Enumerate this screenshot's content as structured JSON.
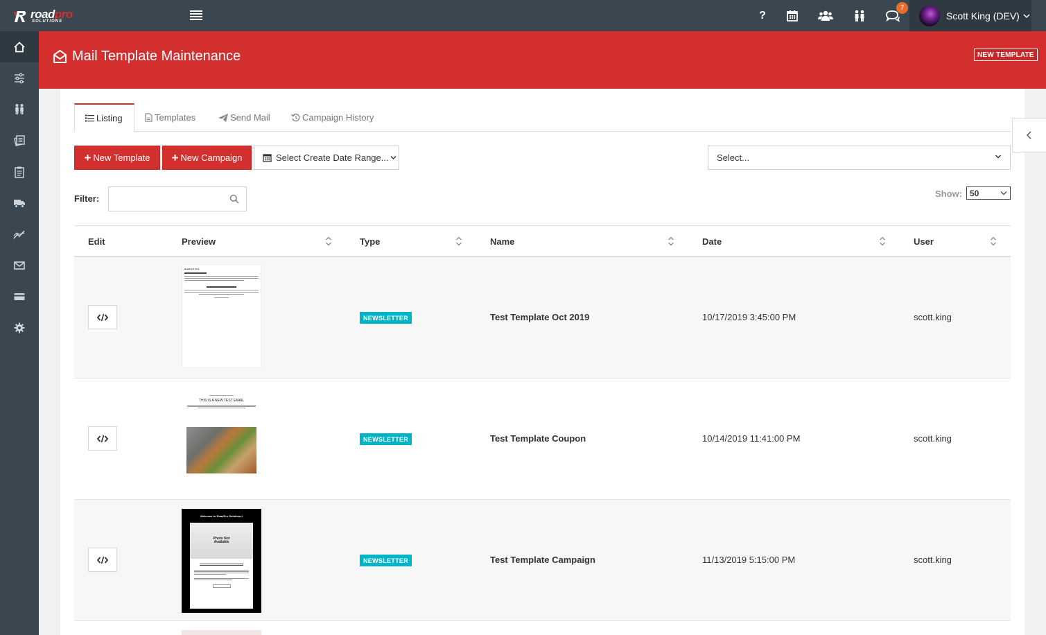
{
  "app": {
    "logo_main": "road",
    "logo_accent": "pro",
    "logo_sub": "SOLUTIONS",
    "notification_count": "7",
    "user_name": "Scott King (DEV)",
    "help_label": "?"
  },
  "page": {
    "title": "Mail Template Maintenance",
    "new_template_badge": "NEW TEMPLATE"
  },
  "tabs": [
    {
      "label": "Listing",
      "icon": "list-icon",
      "active": true
    },
    {
      "label": "Templates",
      "icon": "file-icon",
      "active": false
    },
    {
      "label": "Send Mail",
      "icon": "paper-plane-icon",
      "active": false
    },
    {
      "label": "Campaign History",
      "icon": "history-icon",
      "active": false
    }
  ],
  "toolbar": {
    "new_template": "New Template",
    "new_campaign": "New Campaign",
    "date_range": "Select Create Date Range...",
    "select_placeholder": "Select..."
  },
  "filter": {
    "label": "Filter:",
    "value": "",
    "show_label": "Show:",
    "show_value": "50"
  },
  "table": {
    "columns": [
      "Edit",
      "Preview",
      "Type",
      "Name",
      "Date",
      "User"
    ],
    "rows": [
      {
        "type": "NEWSLETTER",
        "name": "Test Template Oct 2019",
        "date": "10/17/2019 3:45:00 PM",
        "user": "scott.king",
        "preview_title": "Heading 2 here",
        "preview_sub": ""
      },
      {
        "type": "NEWSLETTER",
        "name": "Test Template Coupon",
        "date": "10/14/2019 11:41:00 PM",
        "user": "scott.king",
        "preview_title": "THIS IS A NEW TEST EMAIL",
        "preview_sub": ""
      },
      {
        "type": "NEWSLETTER",
        "name": "Test Template Campaign",
        "date": "11/13/2019 5:15:00 PM",
        "user": "scott.king",
        "preview_title": "Welcome to RoadPro Solutions!",
        "preview_sub": "Photo Not Available"
      }
    ]
  },
  "colors": {
    "brand_red": "#d32f2f",
    "sidebar": "#3b4750",
    "badge_teal": "#00b4c8",
    "notification": "#e96b2e"
  }
}
